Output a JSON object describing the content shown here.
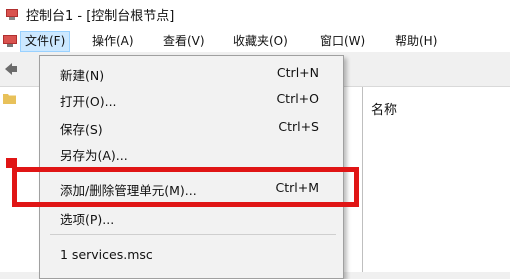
{
  "window": {
    "title": "控制台1 - [控制台根节点]"
  },
  "menubar": {
    "items": [
      {
        "label": "文件(F)",
        "active": true
      },
      {
        "label": "操作(A)"
      },
      {
        "label": "查看(V)"
      },
      {
        "label": "收藏夹(O)"
      },
      {
        "label": "窗口(W)"
      },
      {
        "label": "帮助(H)"
      }
    ]
  },
  "right_pane": {
    "column_header": "名称"
  },
  "file_menu": {
    "items": [
      {
        "label": "新建(N)",
        "shortcut": "Ctrl+N"
      },
      {
        "label": "打开(O)...",
        "shortcut": "Ctrl+O"
      },
      {
        "label": "保存(S)",
        "shortcut": "Ctrl+S"
      },
      {
        "label": "另存为(A)...",
        "shortcut": ""
      },
      {
        "label": "添加/删除管理单元(M)...",
        "shortcut": "Ctrl+M",
        "highlighted": true
      },
      {
        "label": "选项(P)...",
        "shortcut": ""
      },
      {
        "label": "1 services.msc",
        "shortcut": ""
      }
    ]
  },
  "colors": {
    "highlight_box": "#e01515",
    "menu_active_bg": "#cce8ff"
  },
  "icons": {
    "app": "mmc-console-icon",
    "back": "back-arrow-icon",
    "folder": "folder-icon"
  }
}
